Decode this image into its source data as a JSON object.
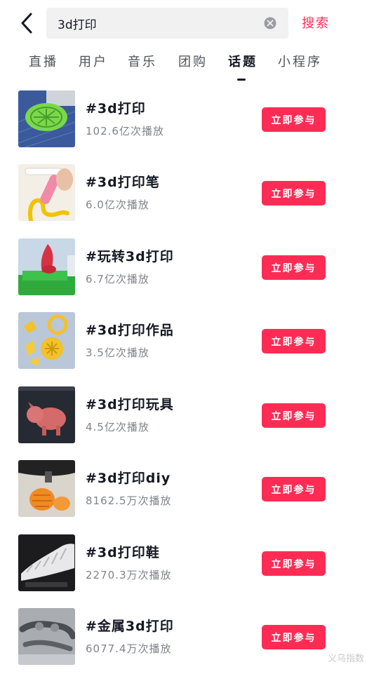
{
  "header": {
    "search_value": "3d打印",
    "search_button": "搜索"
  },
  "tabs": [
    {
      "label": "直播"
    },
    {
      "label": "用户"
    },
    {
      "label": "音乐"
    },
    {
      "label": "团购"
    },
    {
      "label": "话题"
    },
    {
      "label": "小程序"
    }
  ],
  "active_tab": "话题",
  "topics": [
    {
      "title": "#3d打印",
      "plays": "102.6亿次播放",
      "action": "立即参与"
    },
    {
      "title": "#3d打印笔",
      "plays": "6.0亿次播放",
      "action": "立即参与"
    },
    {
      "title": "#玩转3d打印",
      "plays": "6.7亿次播放",
      "action": "立即参与"
    },
    {
      "title": "#3d打印作品",
      "plays": "3.5亿次播放",
      "action": "立即参与"
    },
    {
      "title": "#3d打印玩具",
      "plays": "4.5亿次播放",
      "action": "立即参与"
    },
    {
      "title": "#3d打印diy",
      "plays": "8162.5万次播放",
      "action": "立即参与"
    },
    {
      "title": "#3d打印鞋",
      "plays": "2270.3万次播放",
      "action": "立即参与"
    },
    {
      "title": "#金属3d打印",
      "plays": "6077.4万次播放",
      "action": "立即参与"
    }
  ],
  "watermark": "义乌指数",
  "colors": {
    "accent": "#fe2c55",
    "text": "#161823",
    "secondary": "#80838a"
  }
}
